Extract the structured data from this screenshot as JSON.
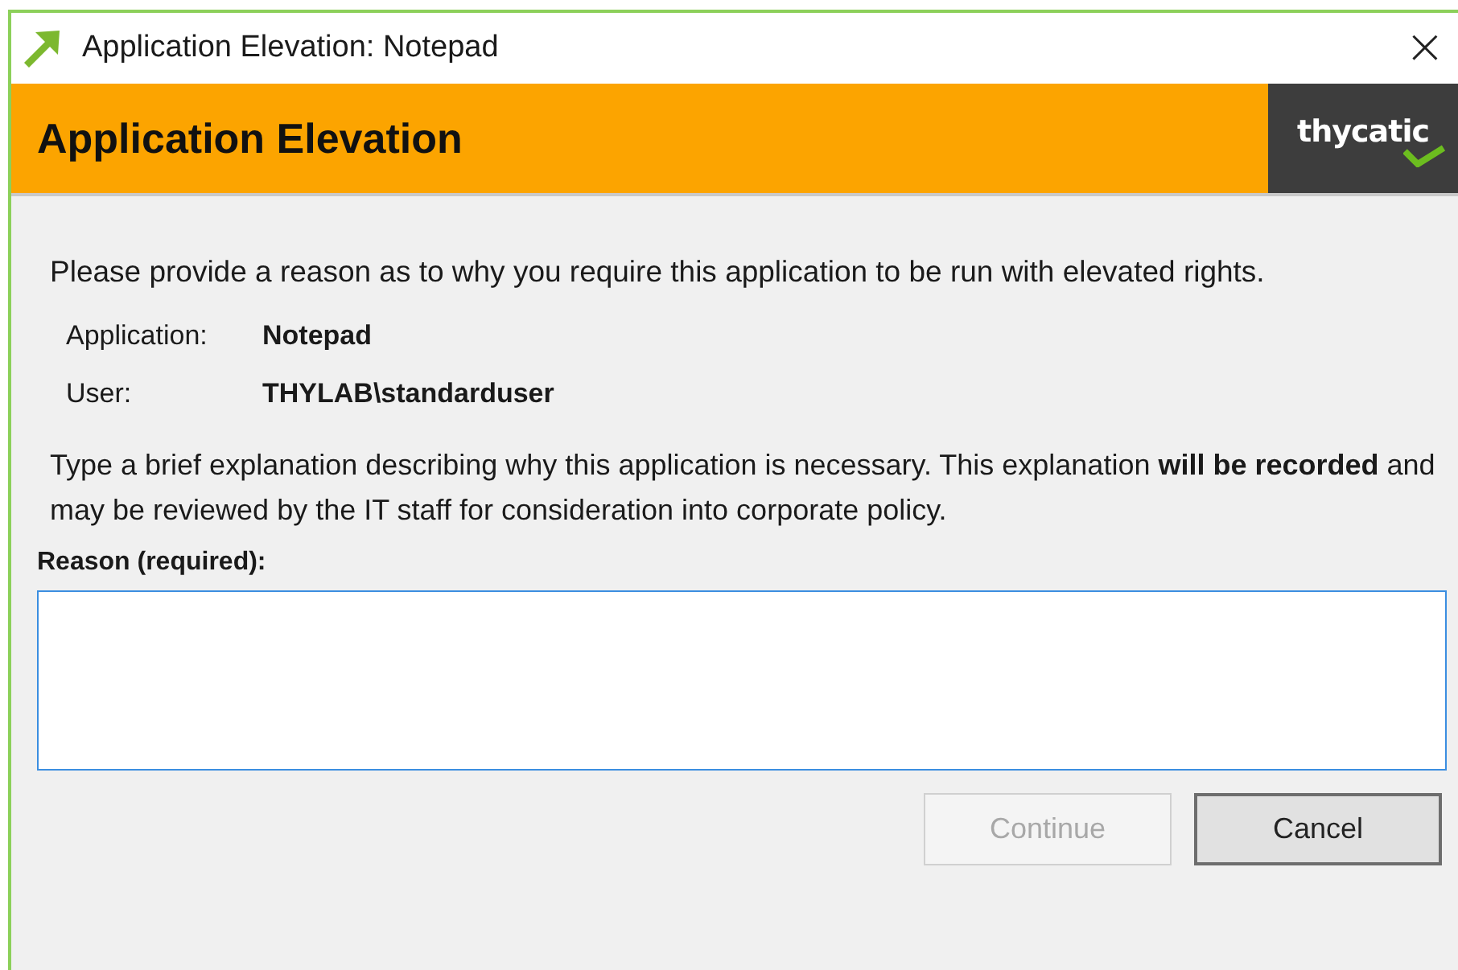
{
  "window": {
    "title": "Application Elevation: Notepad",
    "close": "×"
  },
  "header": {
    "title": "Application Elevation",
    "logo": "thycatic"
  },
  "intro": "Please provide a reason as to why you require this application to be run with elevated rights.",
  "details": [
    {
      "label": "Application:",
      "value": "Notepad"
    },
    {
      "label": "User:",
      "value": "THYLAB\\standarduser"
    }
  ],
  "explanation": "Type a brief explanation describing why this application is necessary. This explanation **will be recorded** and may be reviewed by the IT staff for consideration into corporate policy.",
  "reason": {
    "label": "Reason (required):"
  },
  "buttons": [
    {
      "label": "Continue",
      "disabled": true
    },
    {
      "label": "Cancel",
      "disabled": false
    }
  ]
}
